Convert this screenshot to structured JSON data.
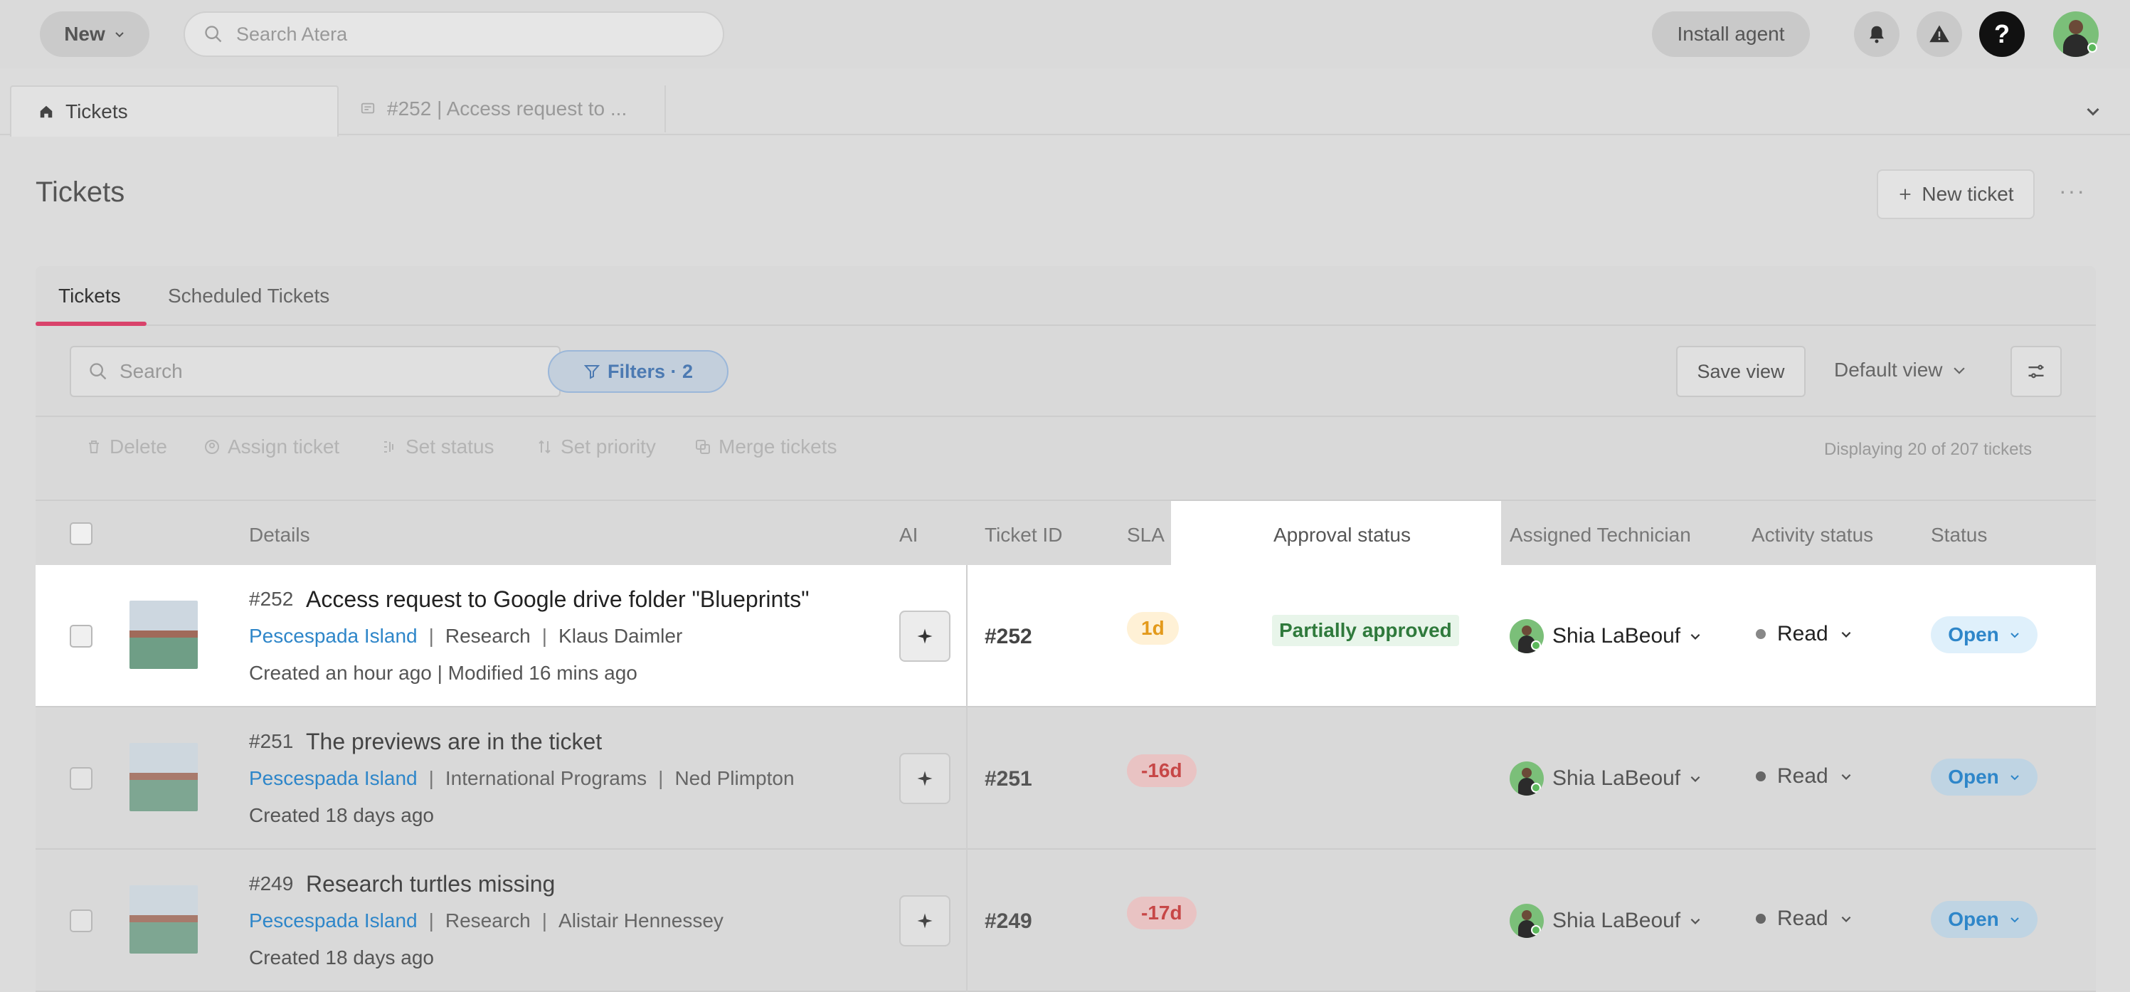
{
  "topbar": {
    "new_label": "New",
    "search_placeholder": "Search Atera",
    "install_agent": "Install agent",
    "help_label": "?"
  },
  "tabs": {
    "tickets": "Tickets",
    "ticket_252": "#252 | Access request to ..."
  },
  "page": {
    "title": "Tickets",
    "new_ticket": "New ticket",
    "more": "···"
  },
  "sub_tabs": [
    "Tickets",
    "Scheduled Tickets"
  ],
  "filter_bar": {
    "search_placeholder": "Search",
    "filters": "Filters · 2",
    "save_view": "Save view",
    "default_view": "Default view"
  },
  "bulk_actions": {
    "delete": "Delete",
    "assign": "Assign ticket",
    "set_status": "Set status",
    "set_priority": "Set priority",
    "merge": "Merge tickets",
    "displaying": "Displaying 20 of 207 tickets"
  },
  "columns": {
    "details": "Details",
    "ai": "AI",
    "ticket_id": "Ticket ID",
    "sla": "SLA",
    "approval_status": "Approval status",
    "assigned_technician": "Assigned Technician",
    "activity_status": "Activity status",
    "status": "Status"
  },
  "rows": [
    {
      "num": "#252",
      "title": "Access request to Google drive folder \"Blueprints\"",
      "customer": "Pescespada Island",
      "department": "Research",
      "contact": "Klaus Daimler",
      "created": "Created an hour ago | Modified 16 mins ago",
      "ticket_id": "#252",
      "sla": "1d",
      "approval": "Partially approved",
      "technician": "Shia LaBeouf",
      "activity": "Read",
      "status": "Open"
    },
    {
      "num": "#251",
      "title": "The previews are in the ticket",
      "customer": "Pescespada Island",
      "department": "International Programs",
      "contact": "Ned Plimpton",
      "created": "Created 18 days ago",
      "ticket_id": "#251",
      "sla": "-16d",
      "approval": "",
      "technician": "Shia LaBeouf",
      "activity": "Read",
      "status": "Open"
    },
    {
      "num": "#249",
      "title": "Research turtles missing",
      "customer": "Pescespada Island",
      "department": "Research",
      "contact": "Alistair Hennessey",
      "created": "Created 18 days ago",
      "ticket_id": "#249",
      "sla": "-17d",
      "approval": "",
      "technician": "Shia LaBeouf",
      "activity": "Read",
      "status": "Open"
    }
  ],
  "colors": {
    "accent_pink": "#d9436b",
    "link_blue": "#2e86c9",
    "approval_green": "#2f7a3c",
    "sla_warn": "#e39a1c",
    "sla_late": "#c74747"
  },
  "icons": [
    "chevron-down-icon",
    "search-icon",
    "bell-icon",
    "warning-icon",
    "home-icon",
    "ticket-icon",
    "plus-icon",
    "filter-icon",
    "adjust-icon",
    "trash-icon",
    "assign-icon",
    "status-icon",
    "priority-icon",
    "merge-icon",
    "sparkle-icon"
  ]
}
